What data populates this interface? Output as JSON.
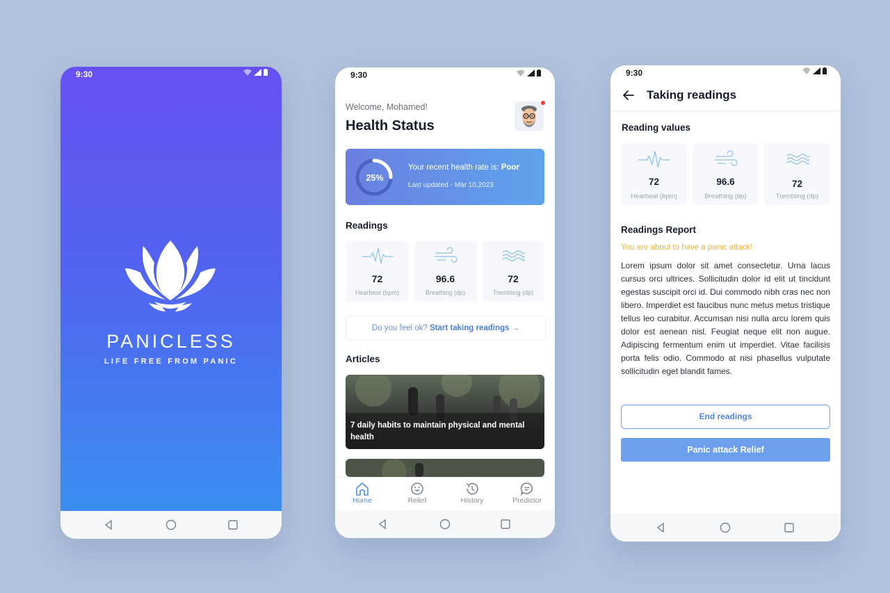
{
  "status_bar": {
    "time": "9:30"
  },
  "splash": {
    "brand": "PANICLESS",
    "tagline": "LIFE FREE FROM PANIC"
  },
  "home": {
    "welcome": "Welcome, Mohamed!",
    "title": "Health Status",
    "health_card": {
      "percent_label": "25%",
      "percent_value": 25,
      "rate_text": "Your recent health rate is:",
      "rate_value": "Poor",
      "updated": "Last updated - Mar 10,2023"
    },
    "readings_title": "Readings",
    "readings": [
      {
        "value": "72",
        "label": "Hearbeat (bpm)",
        "icon": "heartbeat-icon"
      },
      {
        "value": "96.6",
        "label": "Breathing (dp)",
        "icon": "wind-icon"
      },
      {
        "value": "72",
        "label": "Trembling (dp)",
        "icon": "waves-icon"
      }
    ],
    "prompt_text": "Do you feel ok?",
    "prompt_link": "Start taking readings",
    "articles_title": "Articles",
    "articles": [
      {
        "title": "7 daily habits to maintain physical and mental health"
      }
    ],
    "tabs": [
      {
        "label": "Home",
        "icon": "home-icon",
        "active": true
      },
      {
        "label": "Relief",
        "icon": "smile-icon",
        "active": false
      },
      {
        "label": "History",
        "icon": "history-icon",
        "active": false
      },
      {
        "label": "Predictor",
        "icon": "chat-icon",
        "active": false
      }
    ]
  },
  "readings_screen": {
    "title": "Taking readings",
    "values_title": "Reading values",
    "values": [
      {
        "value": "72",
        "label": "Hearbeat (bpm)",
        "icon": "heartbeat-icon"
      },
      {
        "value": "96.6",
        "label": "Breathing (dp)",
        "icon": "wind-icon"
      },
      {
        "value": "72",
        "label": "Trembling (dp)",
        "icon": "waves-icon"
      }
    ],
    "report_title": "Readings Report",
    "warning": "You are about to have a panic attack!",
    "report_body": "Lorem ipsum dolor sit amet consectetur. Urna lacus cursus orci ultrices. Sollicitudin dolor id elit ut tincidunt egestas suscipit orci id. Dui commodo nibh cras nec non libero. Imperdiet est faucibus nunc metus metus tristique tellus leo curabitur. Accumsan nisi nulla arcu lorem quis dolor est aenean nisl. Feugiat neque elit non augue. Adipiscing fermentum enim ut imperdiet. Vitae facilisis porta felis odio. Commodo at nisi phasellus vulputate sollicitudin eget blandit fames.",
    "end_button": "End readings",
    "relief_button": "Panic attack Relief"
  },
  "colors": {
    "accent": "#4b8ff0",
    "splash_top": "#6750f2",
    "splash_bottom": "#3b8ef0",
    "warning": "#f3b33b"
  }
}
